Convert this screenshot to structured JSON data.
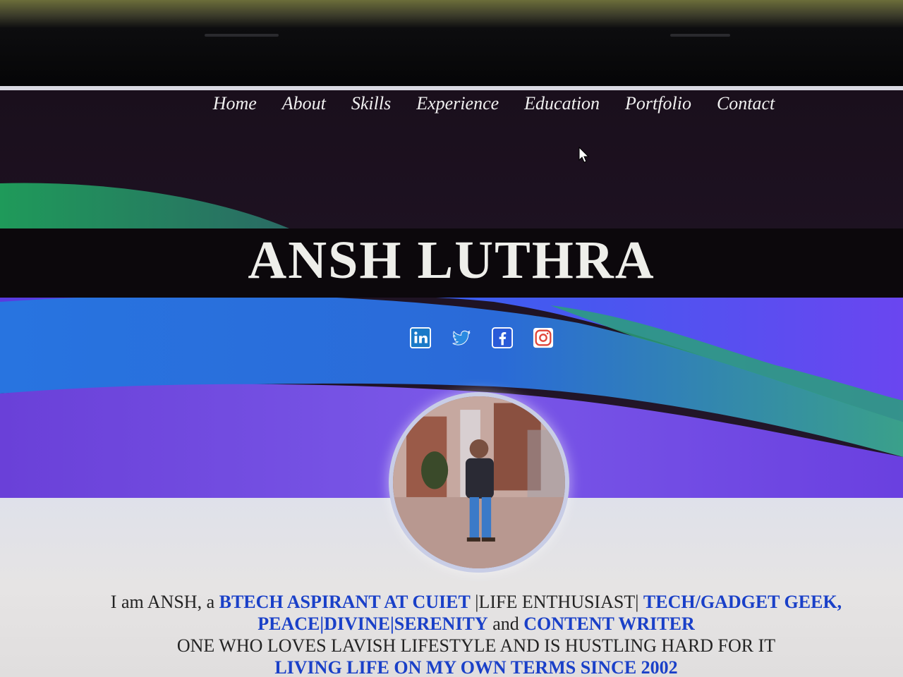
{
  "nav": {
    "items": [
      {
        "label": "Home"
      },
      {
        "label": "About"
      },
      {
        "label": "Skills"
      },
      {
        "label": "Experience"
      },
      {
        "label": "Education"
      },
      {
        "label": "Portfolio"
      },
      {
        "label": "Contact"
      }
    ]
  },
  "hero": {
    "title": "ANSH LUTHRA"
  },
  "socials": {
    "items": [
      {
        "icon": "linkedin-icon"
      },
      {
        "icon": "twitter-icon"
      },
      {
        "icon": "facebook-icon"
      },
      {
        "icon": "instagram-icon"
      }
    ]
  },
  "intro": {
    "p1": "I am ANSH, a ",
    "h1": "BTECH ASPIRANT AT CUIET",
    "p2": " |LIFE ENTHUSIAST| ",
    "h2": "TECH/GADGET GEEK, PEACE|DIVINE|SERENITY",
    "p3": " and ",
    "h3": "CONTENT WRITER",
    "line3": "ONE WHO LOVES LAVISH LIFESTYLE AND IS HUSTLING HARD FOR IT",
    "line4": "LIVING LIFE ON MY OWN TERMS SINCE 2002"
  },
  "colors": {
    "nav_text": "#f0f0f0",
    "highlight": "#1a40c8",
    "title": "#eeeeea"
  }
}
